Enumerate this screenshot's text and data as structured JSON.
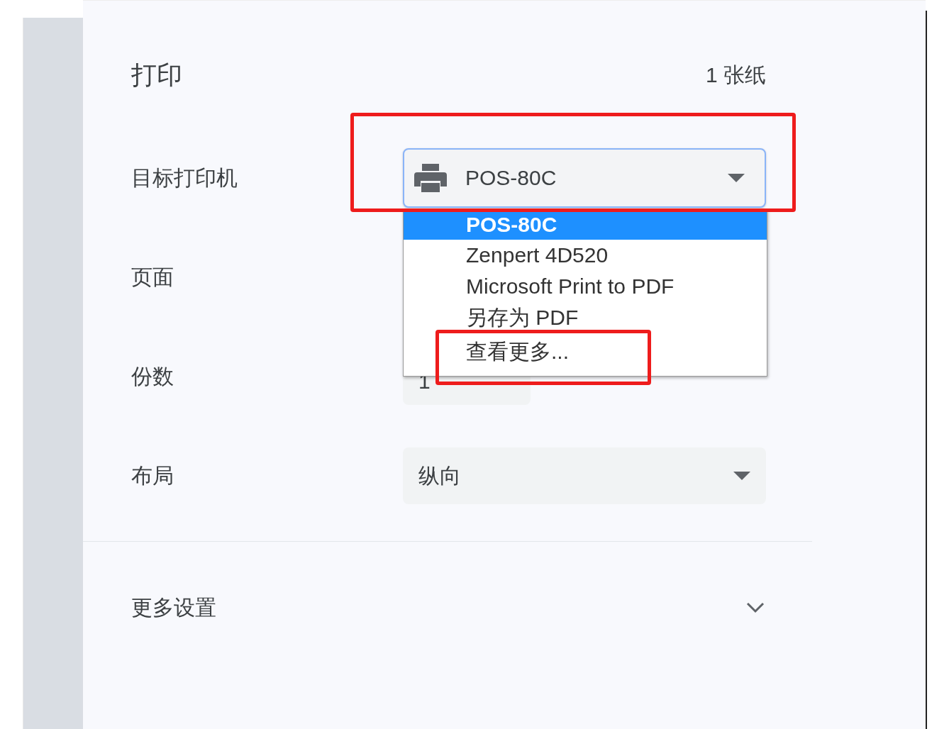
{
  "title": "打印",
  "sheet_count": "1 张纸",
  "rows": [
    {
      "kind": "printer",
      "label": "目标打印机",
      "value": "POS-80C",
      "expanded": true,
      "options": [
        {
          "label": "POS-80C",
          "selected": true
        },
        {
          "label": "Zenpert 4D520",
          "selected": false
        },
        {
          "label": "Microsoft Print to PDF",
          "selected": false
        },
        {
          "label": "另存为 PDF",
          "selected": false
        },
        {
          "label": "查看更多...",
          "selected": false
        }
      ]
    },
    {
      "kind": "pages",
      "label": "页面"
    },
    {
      "kind": "copies",
      "label": "份数",
      "value": "1"
    },
    {
      "kind": "select",
      "label": "布局",
      "value": "纵向"
    }
  ],
  "more_settings": {
    "label": "更多设置",
    "expanded": false
  }
}
